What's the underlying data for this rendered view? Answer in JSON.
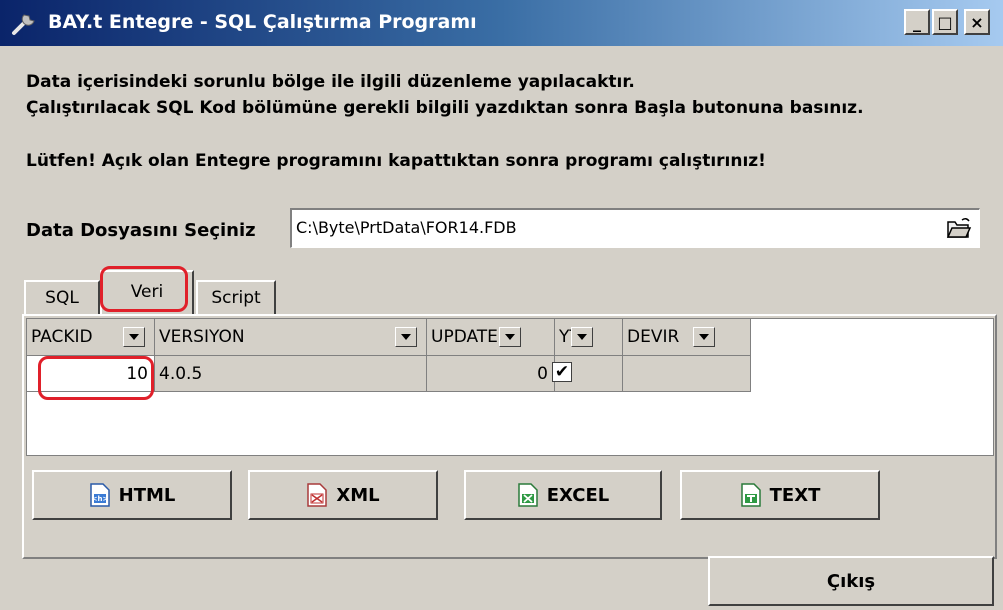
{
  "window": {
    "title": "BAY.t Entegre - SQL Çalıştırma Programı",
    "controls": {
      "minimize": "_",
      "maximize": "□",
      "close": "×"
    }
  },
  "description": {
    "line1": "Data içerisindeki sorunlu bölge ile ilgili düzenleme yapılacaktır.",
    "line2": "Çalıştırılacak SQL Kod bölümüne gerekli bilgili yazdıktan sonra Başla butonuna basınız.",
    "warning": "Lütfen! Açık olan Entegre programını kapattıktan sonra programı çalıştırınız!"
  },
  "file": {
    "label": "Data Dosyasını Seçiniz",
    "value": "C:\\Byte\\PrtData\\FOR14.FDB",
    "browse_icon": "folder-open-icon"
  },
  "tabs": [
    {
      "label": "SQL",
      "active": false
    },
    {
      "label": "Veri",
      "active": true
    },
    {
      "label": "Script",
      "active": false
    }
  ],
  "grid": {
    "columns": [
      "PACKID",
      "VERSIYON",
      "UPDATES",
      "YT",
      "DEVIR"
    ],
    "rows": [
      {
        "packid": "10",
        "versiyon": "4.0.5",
        "updates": "0",
        "yt": "✔",
        "devir": ""
      }
    ]
  },
  "export_buttons": [
    {
      "label": "HTML",
      "icon": "html-doc-icon"
    },
    {
      "label": "XML",
      "icon": "xml-doc-icon"
    },
    {
      "label": "EXCEL",
      "icon": "excel-doc-icon"
    },
    {
      "label": "TEXT",
      "icon": "text-doc-icon"
    }
  ],
  "exit_button": {
    "label": "Çıkış"
  },
  "colors": {
    "annotation": "#e0202a",
    "titlebar": "#0a246a",
    "face": "#d4d0c8"
  }
}
